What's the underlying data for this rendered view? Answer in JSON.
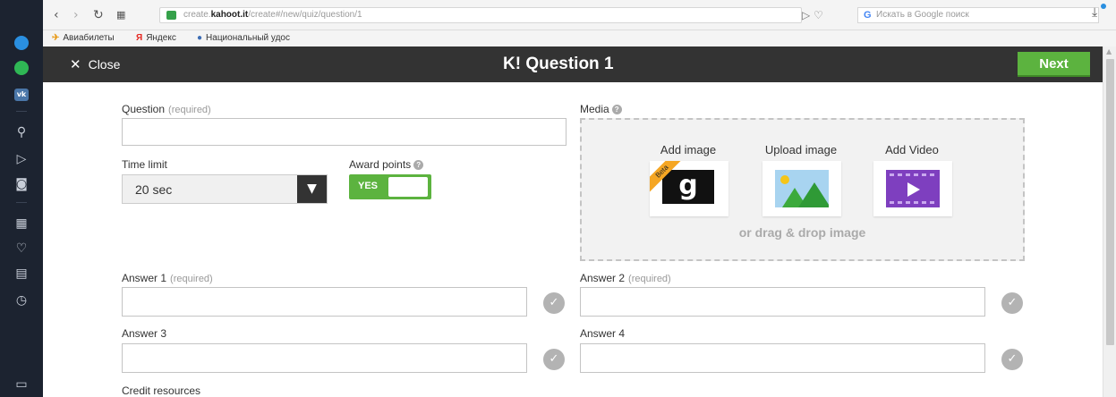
{
  "browser": {
    "url_prefix": "create.",
    "url_host": "kahoot.it",
    "url_path": "/create#/new/quiz/question/1",
    "search_placeholder": "Искать в Google поиск",
    "bookmarks": [
      {
        "label": "Авиабилеты",
        "icon": "plane-icon"
      },
      {
        "label": "Яндекс",
        "icon": "yandex-icon"
      },
      {
        "label": "Национальный удос",
        "icon": "globe-icon"
      }
    ]
  },
  "header": {
    "close_label": "Close",
    "title": "K! Question 1",
    "next_label": "Next"
  },
  "form": {
    "question_label": "Question",
    "required_tag": "(required)",
    "question_value": "",
    "time_limit_label": "Time limit",
    "time_limit_value": "20 sec",
    "award_points_label": "Award points",
    "award_toggle_label": "YES",
    "media_label": "Media",
    "media_options": [
      "Add image",
      "Upload image",
      "Add Video"
    ],
    "beta_label": "Beta",
    "drag_drop_text": "or drag & drop image",
    "answers": [
      {
        "label": "Answer 1",
        "required": "(required)",
        "value": ""
      },
      {
        "label": "Answer 2",
        "required": "(required)",
        "value": ""
      },
      {
        "label": "Answer 3",
        "required": "",
        "value": ""
      },
      {
        "label": "Answer 4",
        "required": "",
        "value": ""
      }
    ],
    "credit_resources_label": "Credit resources"
  },
  "colors": {
    "header_bg": "#333333",
    "accent_green": "#5cb33f",
    "sidebar_bg": "#1c2330"
  }
}
